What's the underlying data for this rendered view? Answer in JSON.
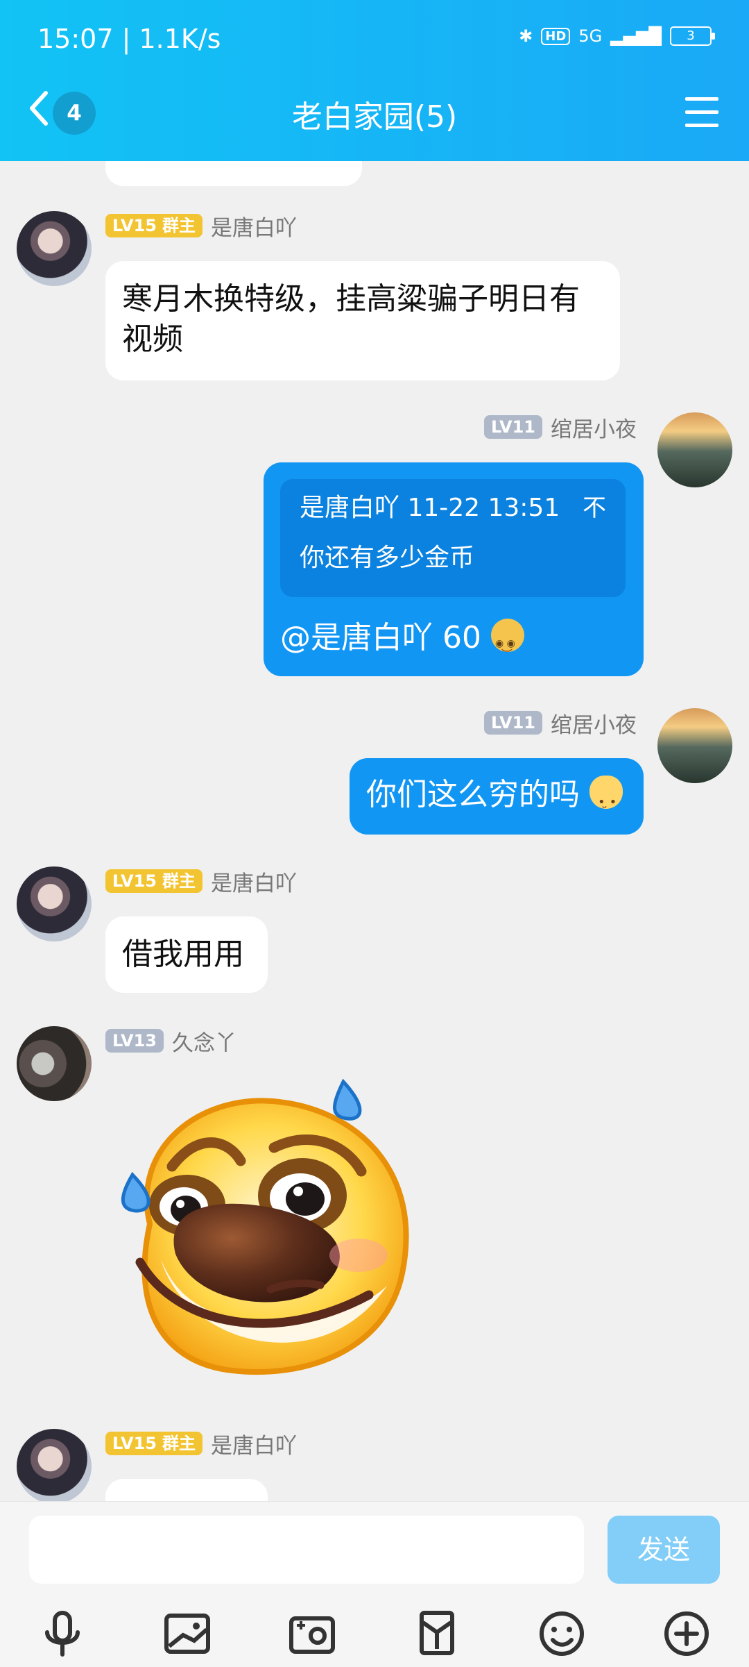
{
  "status_bar": {
    "time_speed": "15:07 | 1.1K/s",
    "hd": "HD",
    "network": "5G",
    "battery": "3"
  },
  "header": {
    "back_badge": "4",
    "title": "老白家园(5)"
  },
  "messages": [
    {
      "sender": "是唐白吖",
      "level": "LV15",
      "role": "群主",
      "text": "寒月木换特级，挂高粱骗子明日有视频"
    },
    {
      "sender": "绾居小夜",
      "level": "LV11",
      "quote_header": "是唐白吖 11-22 13:51",
      "quote_mark": "不",
      "quote_text": "你还有多少金币",
      "reply_text": "@是唐白吖 60"
    },
    {
      "sender": "绾居小夜",
      "level": "LV11",
      "text": "你们这么穷的吗"
    },
    {
      "sender": "是唐白吖",
      "level": "LV15",
      "role": "群主",
      "text": "借我用用"
    },
    {
      "sender": "久念丫",
      "level": "LV13"
    },
    {
      "sender": "是唐白吖",
      "level": "LV15",
      "role": "群主"
    }
  ],
  "composer": {
    "send_label": "发送",
    "input_value": "",
    "input_placeholder": ""
  },
  "colors": {
    "header_start": "#12c3f5",
    "header_end": "#1aa9f6",
    "bubble_blue": "#1296f4",
    "send_disabled": "#82cef8"
  },
  "icons": [
    "microphone-icon",
    "image-icon",
    "camera-icon",
    "red-packet-icon",
    "emoji-icon",
    "plus-icon"
  ]
}
